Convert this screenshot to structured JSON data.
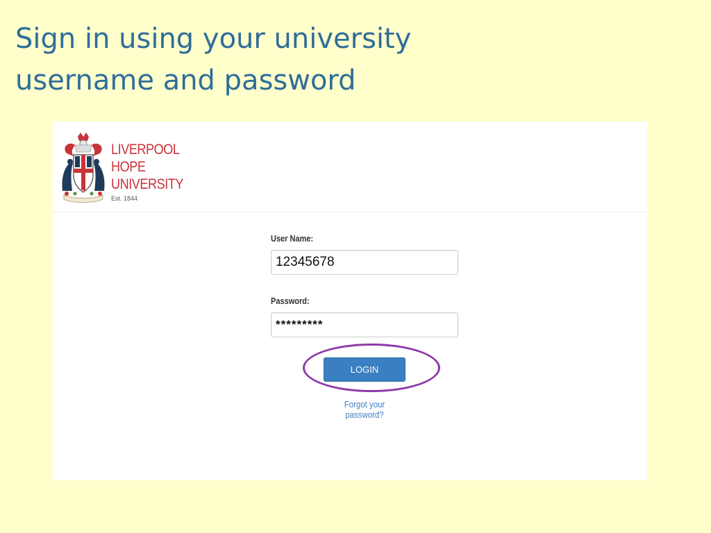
{
  "slide": {
    "title_line1": "Sign in using your university",
    "title_line2": "username and password"
  },
  "login_page": {
    "logo": {
      "wordmark_line1": "LIVERPOOL",
      "wordmark_line2": "HOPE",
      "wordmark_line3": "UNIVERSITY",
      "established": "Est. 1844",
      "icon": "university-crest-icon"
    },
    "username": {
      "label": "User Name:",
      "value": "12345678"
    },
    "password": {
      "label": "Password:",
      "value": "*********"
    },
    "login_button_label": "LOGIN",
    "forgot_link": "Forgot your password?"
  },
  "colors": {
    "slide_background": "#ffffcc",
    "title_text": "#2e6d99",
    "brand_red": "#c8343a",
    "button_blue": "#3a7fc1",
    "highlight_purple": "#8e3aa8"
  }
}
